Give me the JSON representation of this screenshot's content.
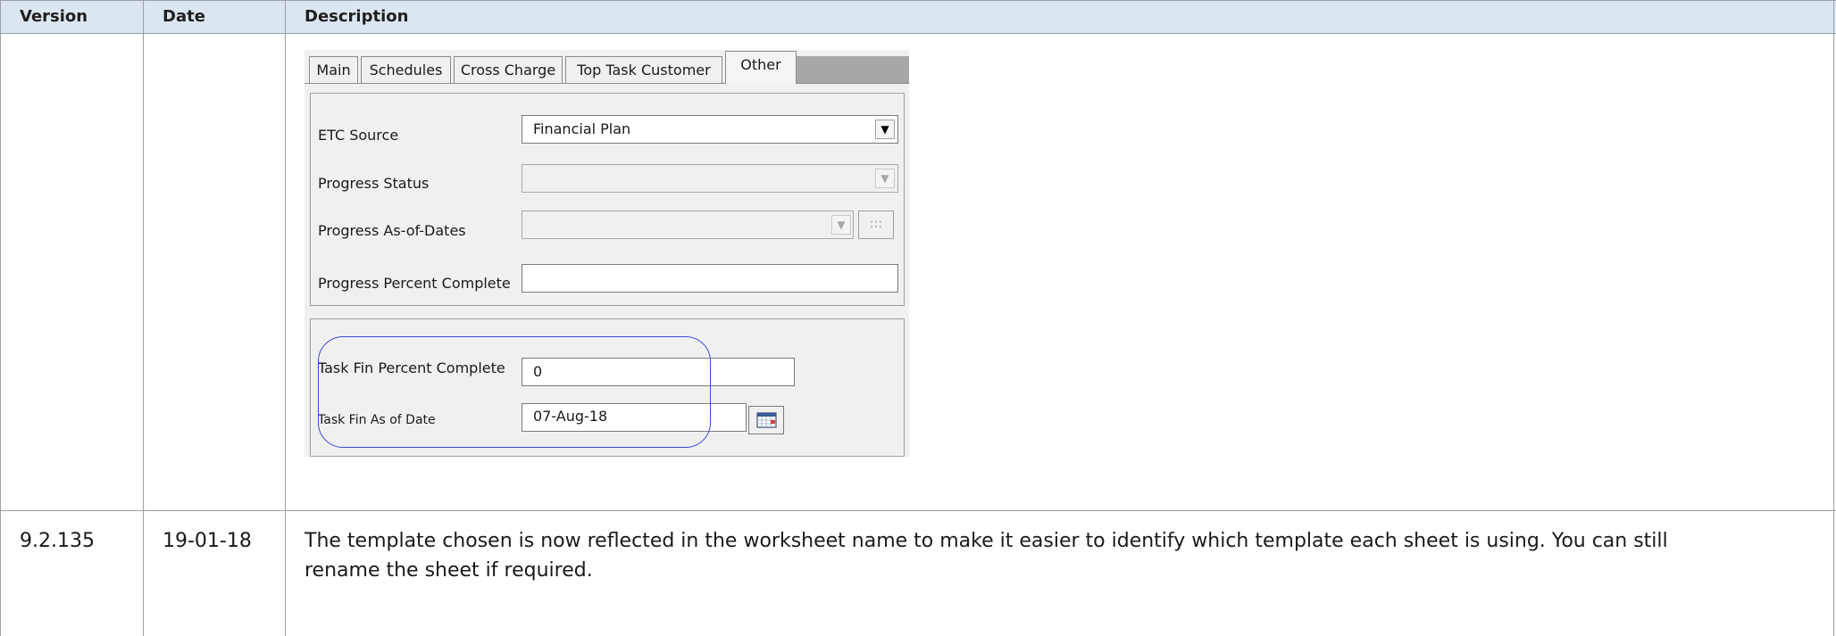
{
  "table": {
    "headers": {
      "version": "Version",
      "date": "Date",
      "description": "Description"
    },
    "rows": [
      {
        "version": "",
        "date": "",
        "description": ""
      },
      {
        "version": "9.2.135",
        "date": "19-01-18",
        "description_line1": "The template chosen is now reflected in the worksheet name to make it easier to identify which template each sheet is using.  You can still",
        "description_line2": "rename the sheet if required."
      }
    ]
  },
  "dialog": {
    "tabs": [
      "Main",
      "Schedules",
      "Cross Charge",
      "Top Task Customer",
      "Other"
    ],
    "active_tab": "Other",
    "fields": {
      "etc_source": {
        "label": "ETC Source",
        "value": "Financial Plan"
      },
      "progress_status": {
        "label": "Progress Status",
        "value": ""
      },
      "progress_as_of_dates": {
        "label": "Progress As-of-Dates",
        "value": ""
      },
      "progress_percent_complete": {
        "label": "Progress Percent Complete",
        "value": ""
      },
      "task_fin_percent_complete": {
        "label": "Task Fin Percent Complete",
        "value": "0"
      },
      "task_fin_as_of_date": {
        "label": "Task Fin As of Date",
        "value": "07-Aug-18"
      }
    },
    "ellipsis_label": ":::",
    "callout_color": "#3b4bd6",
    "icons": [
      "dropdown-arrow-icon",
      "calendar-icon"
    ]
  },
  "colors": {
    "header_bg": "#dce6f1",
    "grid": "#9aa0a6"
  }
}
